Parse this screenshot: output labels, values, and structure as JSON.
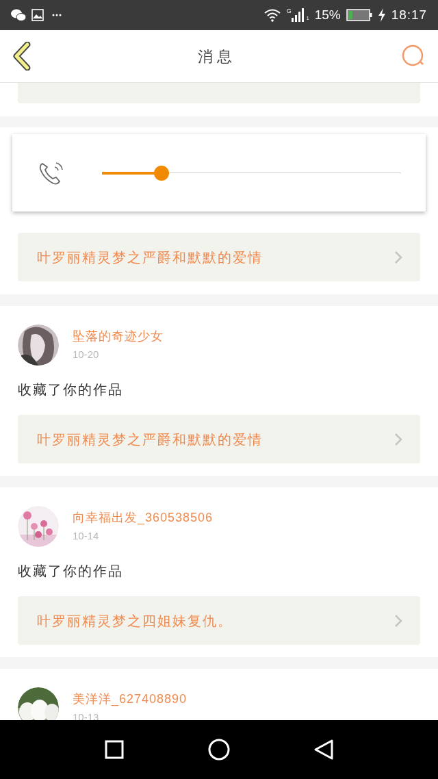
{
  "status_bar": {
    "network": "G",
    "sim": "1",
    "battery": "15%",
    "time": "18:17"
  },
  "header": {
    "title": "消息"
  },
  "volume_popup": {
    "level": 0.2
  },
  "messages": [
    {
      "kind": "covered",
      "work": "叶罗丽精灵梦之严爵和默默的爱情"
    },
    {
      "kind": "full",
      "user": "坠落的奇迹少女",
      "date": "10-20",
      "action": "收藏了你的作品",
      "work": "叶罗丽精灵梦之严爵和默默的爱情"
    },
    {
      "kind": "full",
      "user": "向幸福出发_360538506",
      "date": "10-14",
      "action": "收藏了你的作品",
      "work": "叶罗丽精灵梦之四姐妹复仇。"
    },
    {
      "kind": "cut",
      "user": "美洋洋_627408890",
      "date": "10-13"
    }
  ]
}
